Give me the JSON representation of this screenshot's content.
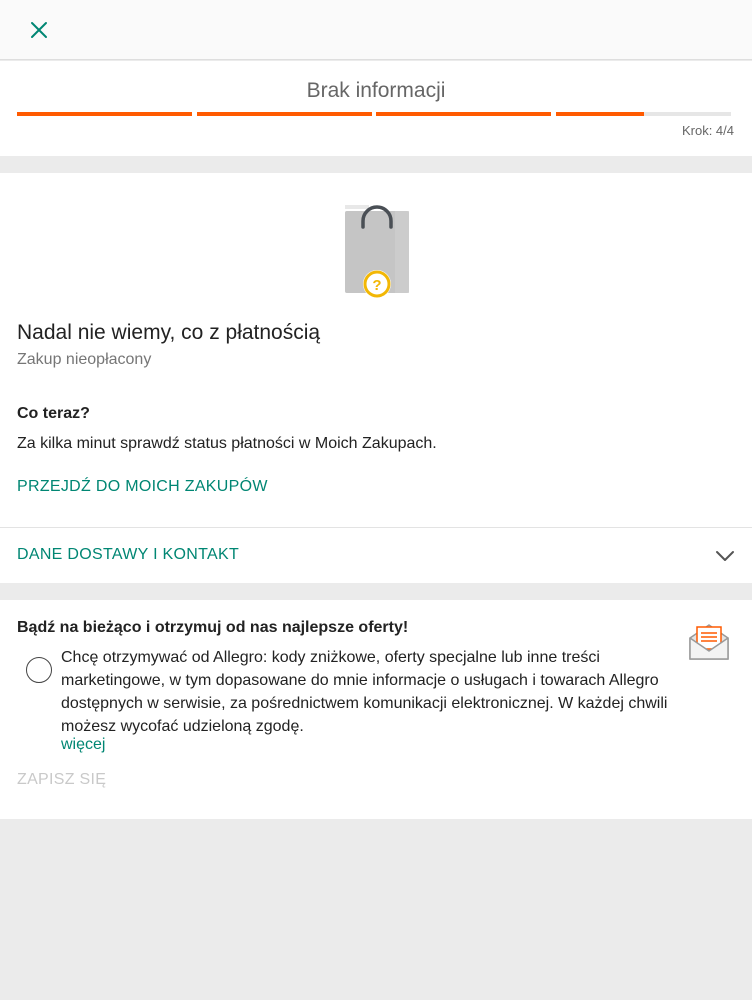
{
  "header": {
    "close_icon": "close-icon"
  },
  "progress": {
    "title": "Brak informacji",
    "step_label": "Krok: 4/4",
    "bars": [
      1,
      1,
      1,
      0.5
    ],
    "accent_color": "#ff5a00"
  },
  "status": {
    "icon": "shopping-bag-question-icon",
    "title": "Nadal nie wiemy, co z płatnością",
    "subtitle": "Zakup nieopłacony"
  },
  "next_steps": {
    "heading": "Co teraz?",
    "text": "Za kilka minut sprawdź status płatności w Moich Zakupach.",
    "link_label": "PRZEJDŹ DO MOICH ZAKUPÓW"
  },
  "delivery": {
    "label": "DANE DOSTAWY I KONTAKT",
    "chevron_icon": "chevron-down-icon"
  },
  "newsletter": {
    "title": "Bądź na bieżąco i otrzymuj od nas najlepsze oferty!",
    "icon": "envelope-icon",
    "consent_text": "Chcę otrzymywać od Allegro: kody zniżkowe, oferty specjalne lub inne treści marketingowe, w tym dopasowane do mnie informacje o usługach i towarach Allegro dostępnych w serwisie, za pośrednictwem komunikacji elektronicznej. W każdej chwili możesz wycofać udzieloną zgodę.",
    "more_label": "więcej",
    "subscribe_label": "ZAPISZ SIĘ"
  },
  "colors": {
    "link": "#008673",
    "accent": "#ff5a00",
    "disabled": "#c9c9c9"
  }
}
